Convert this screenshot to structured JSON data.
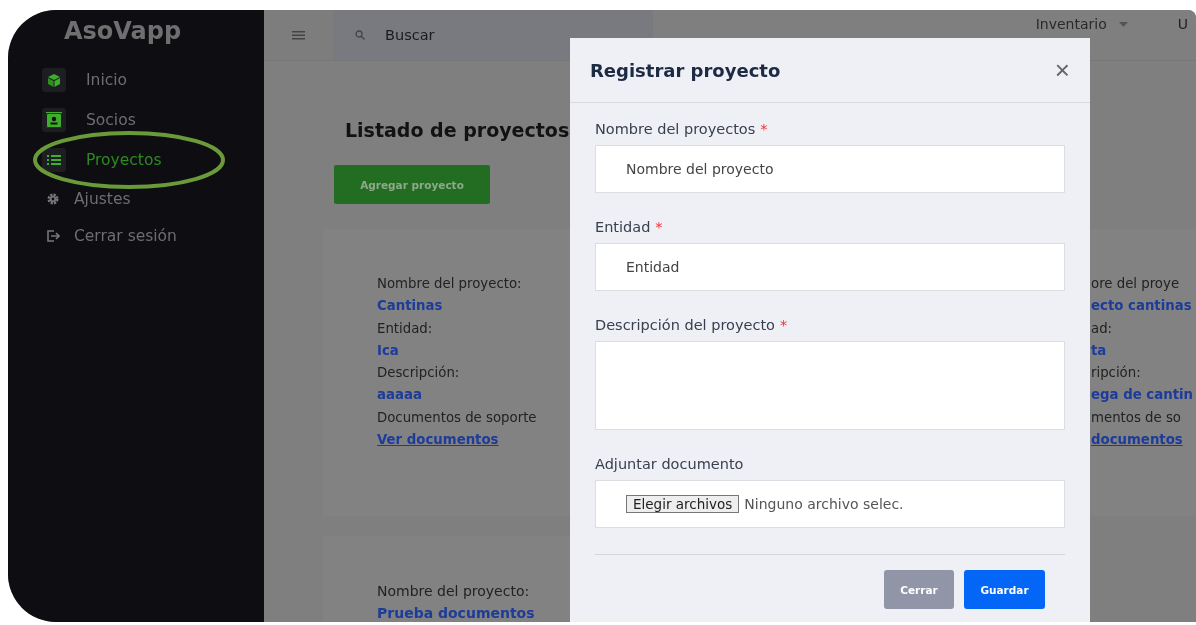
{
  "brand": "AsoVapp",
  "sidebar": {
    "items": [
      {
        "label": "Inicio",
        "kind": "module",
        "selected": false
      },
      {
        "label": "Socios",
        "kind": "module",
        "selected": false
      },
      {
        "label": "Proyectos",
        "kind": "module",
        "selected": true
      },
      {
        "label": "Ajustes",
        "kind": "action",
        "selected": false
      },
      {
        "label": "Cerrar sesión",
        "kind": "action",
        "selected": false
      }
    ]
  },
  "topbar": {
    "search": {
      "placeholder": "Buscar"
    },
    "menu": "Inventario",
    "user": "U"
  },
  "page": {
    "title": "Listado de proyectos",
    "add_button": "Agregar proyecto",
    "cards": [
      {
        "lines": [
          {
            "text": "Nombre del proyecto:",
            "kind": "label"
          },
          {
            "text": "Cantinas",
            "kind": "value"
          },
          {
            "text": "Entidad:",
            "kind": "label"
          },
          {
            "text": "Ica",
            "kind": "value"
          },
          {
            "text": "Descripción:",
            "kind": "label"
          },
          {
            "text": "aaaaa",
            "kind": "value"
          },
          {
            "text": "Documentos de soporte",
            "kind": "label"
          },
          {
            "text": "Ver documentos",
            "kind": "link"
          }
        ]
      },
      {
        "lines": [
          {
            "text": "ore del proye",
            "kind": "label"
          },
          {
            "text": "ecto cantinas",
            "kind": "value"
          },
          {
            "text": "ad:",
            "kind": "label"
          },
          {
            "text": "ta",
            "kind": "value"
          },
          {
            "text": "ripción:",
            "kind": "label"
          },
          {
            "text": "ega de cantin",
            "kind": "value"
          },
          {
            "text": "mentos de so",
            "kind": "label"
          },
          {
            "text": "documentos",
            "kind": "link"
          }
        ]
      },
      {
        "lines": [
          {
            "text": "Nombre del proyecto:",
            "kind": "label"
          },
          {
            "text": "Prueba documentos",
            "kind": "value"
          }
        ]
      }
    ]
  },
  "modal": {
    "title": "Registrar proyecto",
    "close": "×",
    "fields": [
      {
        "label": "Nombre del proyectos",
        "required": true,
        "required_mark": "*",
        "kind": "text",
        "placeholder": "Nombre del proyecto"
      },
      {
        "label": "Entidad",
        "required": true,
        "required_mark": "*",
        "kind": "text",
        "placeholder": "Entidad"
      },
      {
        "label": "Descripción del proyecto",
        "required": true,
        "required_mark": "*",
        "kind": "textarea"
      },
      {
        "label": "Adjuntar documento",
        "kind": "file",
        "button": "Elegir archivos",
        "status": "Ninguno archivo selec."
      }
    ],
    "buttons": [
      {
        "label": "Cerrar",
        "kind": "secondary"
      },
      {
        "label": "Guardar",
        "kind": "primary"
      }
    ]
  }
}
